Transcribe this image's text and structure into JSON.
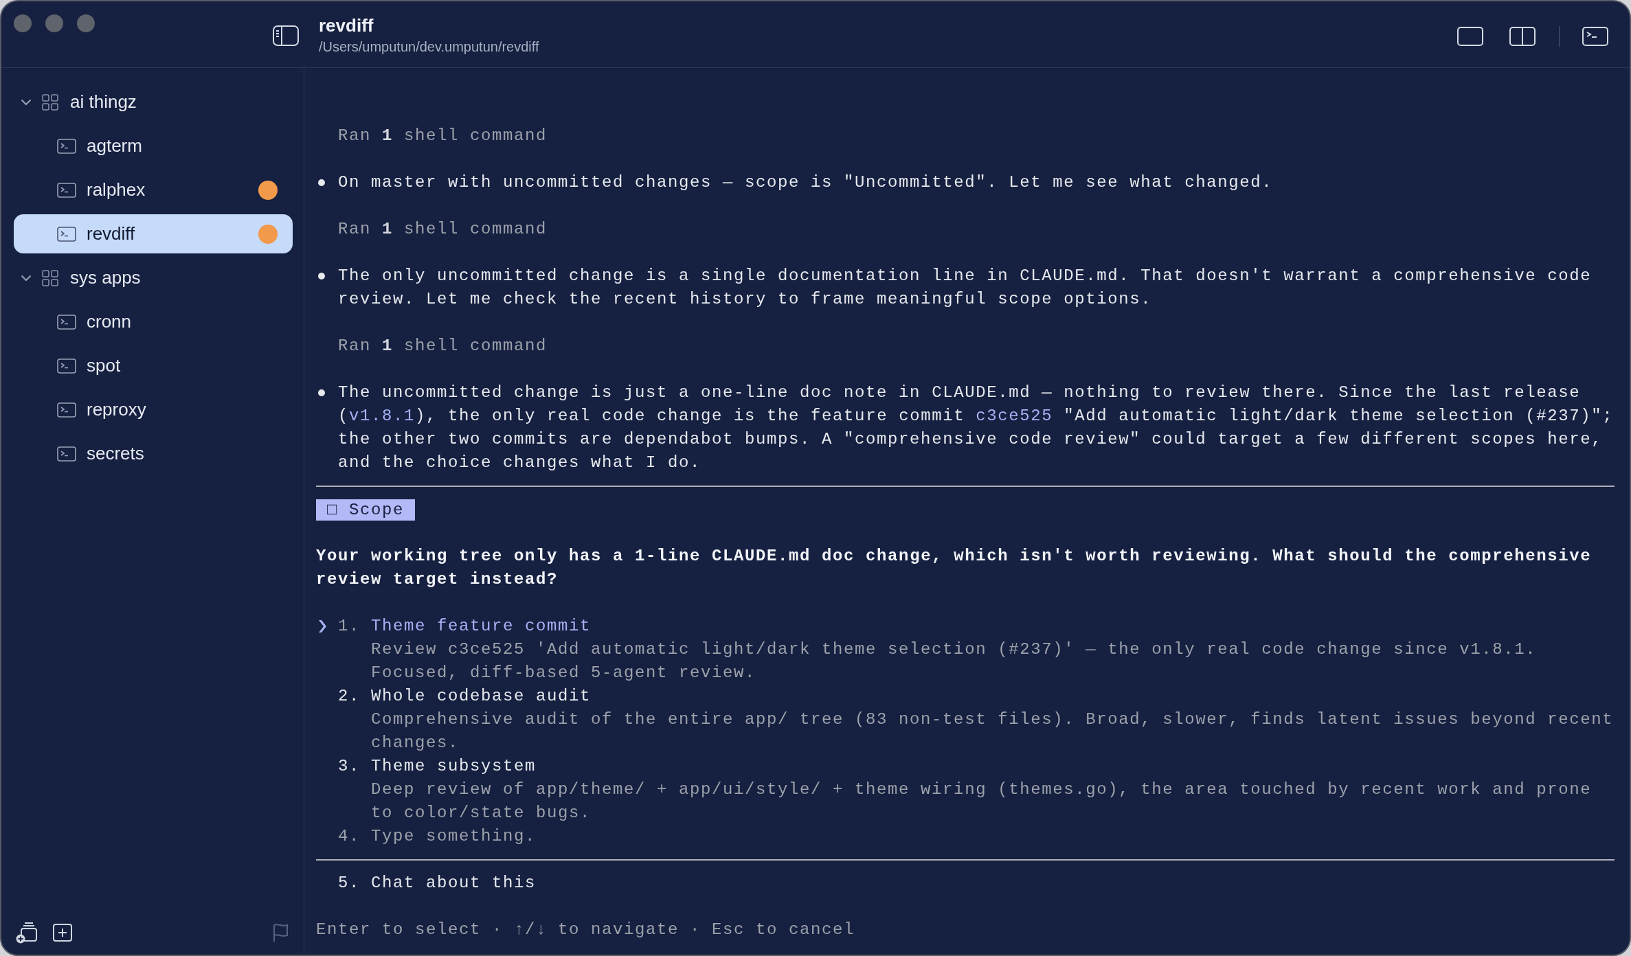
{
  "window": {
    "title": "revdiff",
    "path": "/Users/umputun/dev.umputun/revdiff"
  },
  "sidebar": {
    "groups": [
      {
        "name": "ai thingz",
        "expanded": true,
        "children": [
          {
            "name": "agterm",
            "selected": false,
            "attention": false
          },
          {
            "name": "ralphex",
            "selected": false,
            "attention": true
          },
          {
            "name": "revdiff",
            "selected": true,
            "attention": true
          }
        ]
      },
      {
        "name": "sys apps",
        "expanded": true,
        "children": [
          {
            "name": "cronn",
            "selected": false,
            "attention": false
          },
          {
            "name": "spot",
            "selected": false,
            "attention": false
          },
          {
            "name": "reproxy",
            "selected": false,
            "attention": false
          },
          {
            "name": "secrets",
            "selected": false,
            "attention": false
          }
        ]
      }
    ]
  },
  "terminal": {
    "transcript": [
      {
        "kind": "tool",
        "text": "Ran **1** shell command"
      },
      {
        "kind": "message",
        "segments": [
          {
            "kind": "plain",
            "text": "On master with uncommitted changes — scope is \"Uncommitted\". Let me see what changed."
          }
        ]
      },
      {
        "kind": "tool",
        "text": "Ran **1** shell command"
      },
      {
        "kind": "message",
        "segments": [
          {
            "kind": "plain",
            "text": "The only uncommitted change is a single documentation line in CLAUDE.md. That doesn't warrant a comprehensive code review. Let me check the recent history to frame meaningful scope options."
          }
        ]
      },
      {
        "kind": "tool",
        "text": "Ran **1** shell command"
      },
      {
        "kind": "message",
        "segments": [
          {
            "kind": "plain",
            "text": "The uncommitted change is just a one-line doc note in CLAUDE.md — nothing to review there. Since the last release ("
          },
          {
            "kind": "link",
            "text": "v1.8.1"
          },
          {
            "kind": "plain",
            "text": "), the only real code change is the feature commit "
          },
          {
            "kind": "link",
            "text": "c3ce525"
          },
          {
            "kind": "plain",
            "text": " \"Add automatic light/dark theme selection (#237)\"; the other two commits are dependabot bumps. A \"comprehensive code review\" could target a few different scopes here, and the choice changes what I do."
          }
        ]
      }
    ],
    "prompt": {
      "tag": "□ Scope",
      "question": "Your working tree only has a 1-line CLAUDE.md doc change, which isn't worth reviewing. What should the comprehensive review target instead?",
      "options": [
        {
          "kind": "choice",
          "number": "1.",
          "title": "Theme feature commit",
          "description": "Review c3ce525 'Add automatic light/dark theme selection (#237)' — the only real code change since v1.8.1. Focused, diff-based 5-agent review.",
          "selected": true
        },
        {
          "kind": "choice",
          "number": "2.",
          "title": "Whole codebase audit",
          "description": "Comprehensive audit of the entire app/ tree (83 non-test files). Broad, slower, finds latent issues beyond recent changes.",
          "selected": false
        },
        {
          "kind": "choice",
          "number": "3.",
          "title": "Theme subsystem",
          "description": "Deep review of app/theme/ + app/ui/style/ + theme wiring (themes.go), the area touched by recent work and prone to color/state bugs.",
          "selected": false
        },
        {
          "kind": "input",
          "number": "4.",
          "placeholder": "Type something.",
          "selected": false
        }
      ],
      "footer_options": [
        {
          "kind": "choice",
          "number": "5.",
          "title": "Chat about this",
          "selected": false
        }
      ]
    },
    "hint": "Enter to select · ↑/↓ to navigate · Esc to cancel"
  }
}
